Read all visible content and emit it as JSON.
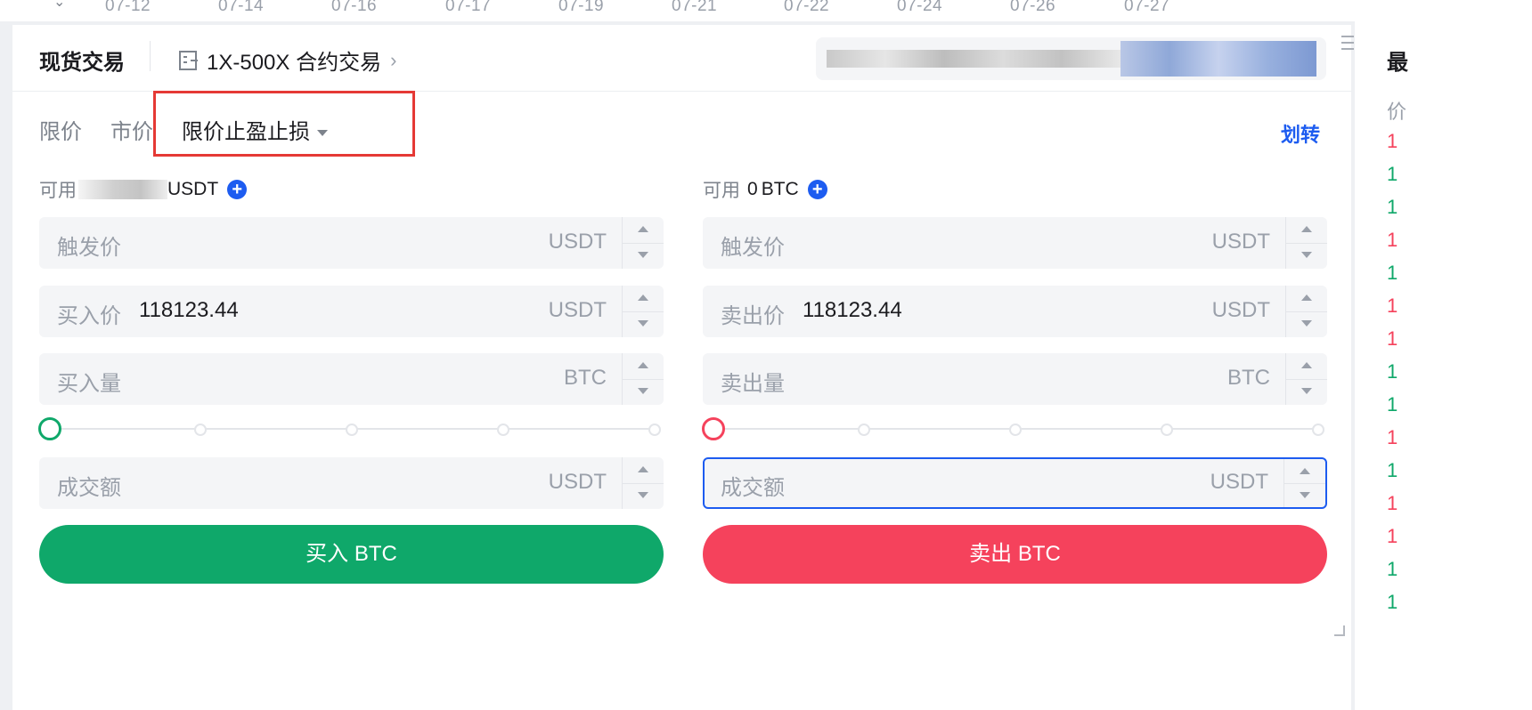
{
  "chart_axis": {
    "dates": [
      "07-12",
      "07-14",
      "07-16",
      "07-17",
      "07-19",
      "07-21",
      "07-22",
      "07-24",
      "07-26",
      "07-27"
    ]
  },
  "header": {
    "spot_tab": "现货交易",
    "contract_link": "1X-500X 合约交易"
  },
  "order_types": {
    "limit": "限价",
    "market": "市价",
    "tpsl": "限价止盈止损"
  },
  "transfer_label": "划转",
  "buy": {
    "avail_label": "可用",
    "avail_unit": "USDT",
    "trigger_label": "触发价",
    "trigger_unit": "USDT",
    "price_label": "买入价",
    "price_value": "118123.44",
    "price_unit": "USDT",
    "qty_label": "买入量",
    "qty_unit": "BTC",
    "amount_label": "成交额",
    "amount_unit": "USDT",
    "button": "买入 BTC",
    "slider_percent": 0
  },
  "sell": {
    "avail_label": "可用",
    "avail_value": "0",
    "avail_unit": "BTC",
    "trigger_label": "触发价",
    "trigger_unit": "USDT",
    "price_label": "卖出价",
    "price_value": "118123.44",
    "price_unit": "USDT",
    "qty_label": "卖出量",
    "qty_unit": "BTC",
    "amount_label": "成交额",
    "amount_unit": "USDT",
    "button": "卖出 BTC",
    "slider_percent": 0
  },
  "right_panel": {
    "title": "最",
    "price_header": "价",
    "rows": [
      "1",
      "1",
      "1",
      "1",
      "1",
      "1",
      "1",
      "1",
      "1",
      "1",
      "1",
      "1",
      "1",
      "1",
      "1"
    ]
  },
  "colors": {
    "buy": "#0fa86a",
    "sell": "#f5425c",
    "accent": "#1d5cf0",
    "highlight": "#e53935"
  }
}
